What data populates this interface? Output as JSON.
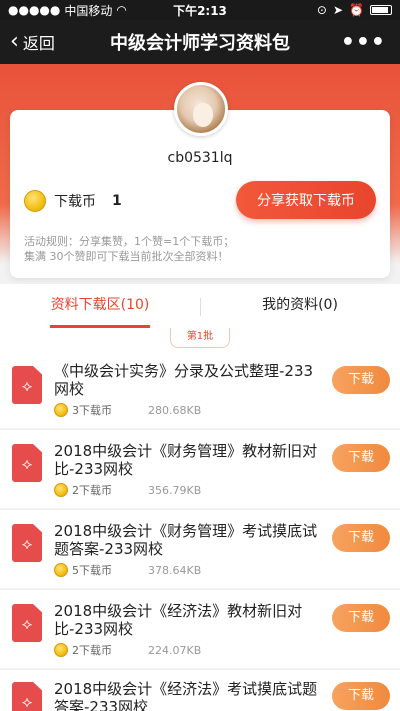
{
  "status": {
    "carrier": "中国移动",
    "time": "下午2:13"
  },
  "nav": {
    "back_label": "返回",
    "title": "中级会计师学习资料包",
    "more_label": "•••"
  },
  "profile": {
    "username": "cb0531lq",
    "coin_label": "下载币",
    "coin_count": "1",
    "share_button": "分享获取下载币",
    "rules_line1": "活动规则：分享集赞，1个赞=1个下载币；",
    "rules_line2": "集满 30个赞即可下载当前批次全部资料！"
  },
  "tabs": [
    {
      "label": "资料下载区(10)",
      "active": true
    },
    {
      "label": "我的资料(0)",
      "active": false
    }
  ],
  "batch_label": "第1批",
  "files": [
    {
      "title": "《中级会计实务》分录及公式整理-233网校",
      "price": "3下载币",
      "size": "280.68KB",
      "button": "下载"
    },
    {
      "title": "2018中级会计《财务管理》教材新旧对比-233网校",
      "price": "2下载币",
      "size": "356.79KB",
      "button": "下载"
    },
    {
      "title": "2018中级会计《财务管理》考试摸底试题答案-233网校",
      "price": "5下载币",
      "size": "378.64KB",
      "button": "下载"
    },
    {
      "title": "2018中级会计《经济法》教材新旧对比-233网校",
      "price": "2下载币",
      "size": "224.07KB",
      "button": "下载"
    },
    {
      "title": "2018中级会计《经济法》考试摸底试题答案-233网校",
      "price": "",
      "size": "",
      "button": "下载"
    }
  ],
  "colors": {
    "accent": "#e8452d",
    "download_button": "#f08a3e",
    "coin": "#f5c21b"
  }
}
